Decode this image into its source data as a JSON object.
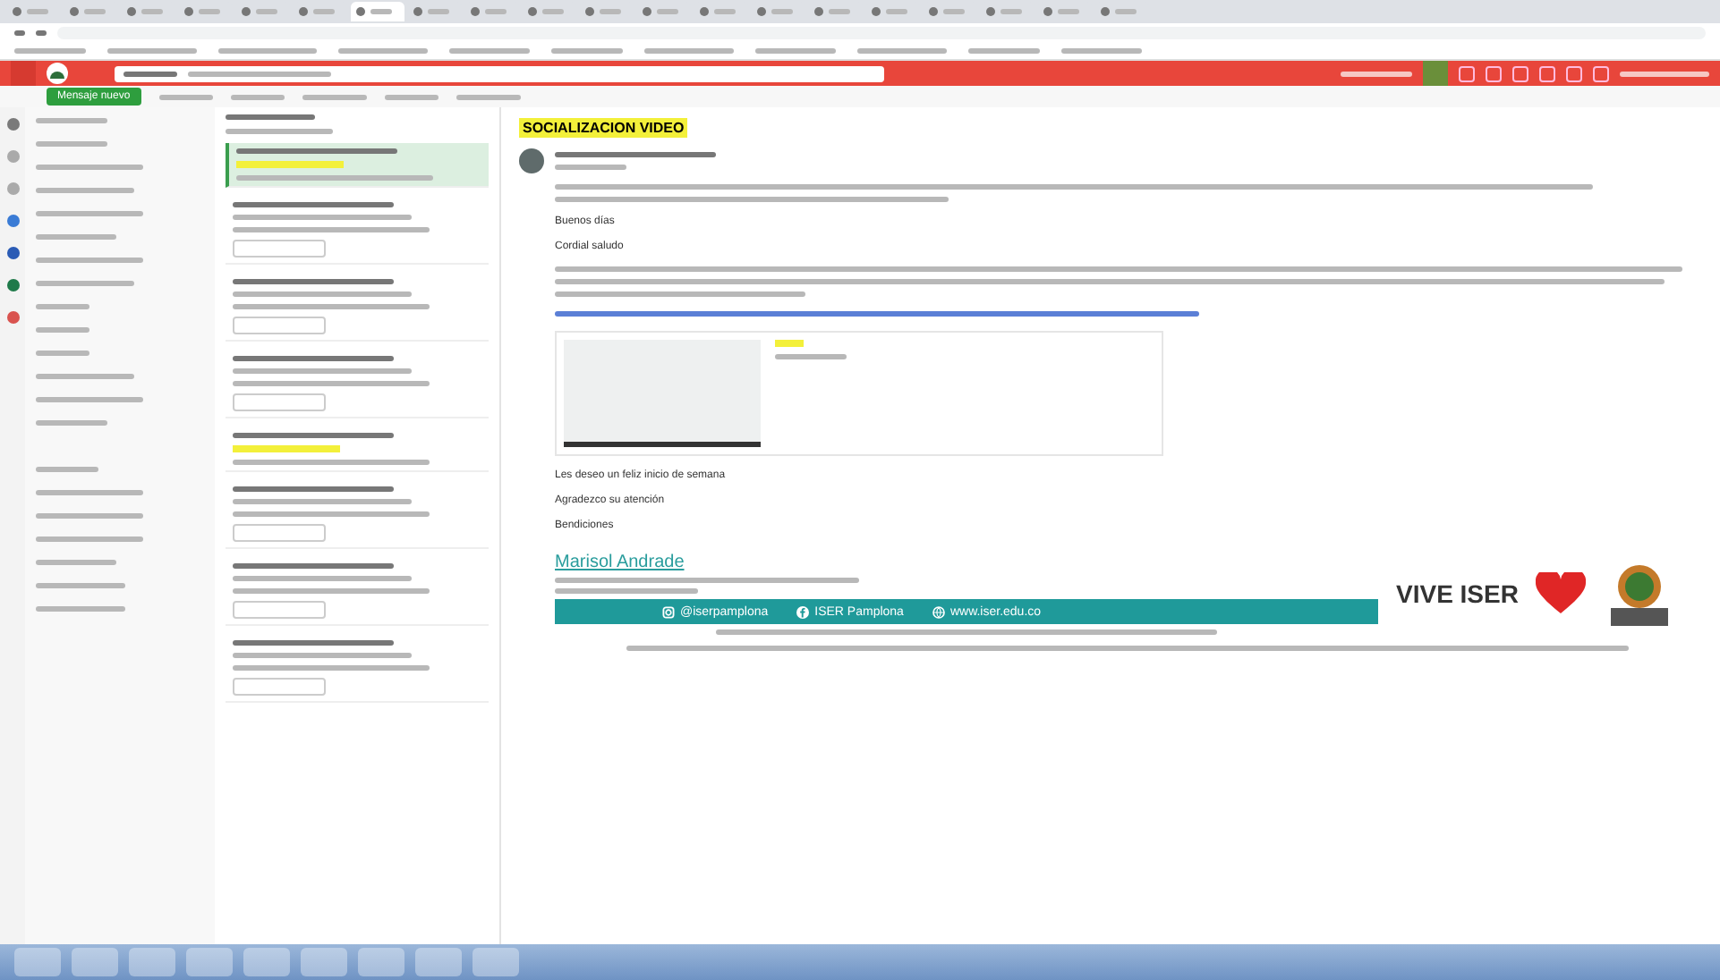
{
  "browser": {
    "tabs": [
      {
        "selected": false
      },
      {
        "selected": false
      },
      {
        "selected": false
      },
      {
        "selected": false
      },
      {
        "selected": false
      },
      {
        "selected": false
      },
      {
        "selected": true
      },
      {
        "selected": false
      },
      {
        "selected": false
      },
      {
        "selected": false
      },
      {
        "selected": false
      },
      {
        "selected": false
      },
      {
        "selected": false
      },
      {
        "selected": false
      },
      {
        "selected": false
      },
      {
        "selected": false
      },
      {
        "selected": false
      },
      {
        "selected": false
      },
      {
        "selected": false
      },
      {
        "selected": false
      }
    ]
  },
  "toolbar": {
    "new_message": "Mensaje nuevo"
  },
  "message_list": {
    "messages": [
      {
        "selected": true,
        "highlighted": true,
        "attachment": false
      },
      {
        "selected": false,
        "highlighted": false,
        "attachment": true
      },
      {
        "selected": false,
        "highlighted": false,
        "attachment": true
      },
      {
        "selected": false,
        "highlighted": false,
        "attachment": true
      },
      {
        "selected": false,
        "highlighted": true,
        "attachment": false
      },
      {
        "selected": false,
        "highlighted": false,
        "attachment": true
      },
      {
        "selected": false,
        "highlighted": false,
        "attachment": true
      },
      {
        "selected": false,
        "highlighted": false,
        "attachment": true
      }
    ]
  },
  "reading_pane": {
    "subject": "SOCIALIZACION VIDEO",
    "greeting": "Buenos días",
    "salutation": "Cordial saludo",
    "closing": [
      "Les deseo un feliz inicio de semana",
      "Agradezco su atención",
      "Bendiciones"
    ]
  },
  "signature": {
    "name": "Marisol Andrade",
    "social": [
      {
        "kind": "instagram",
        "label": "@iserpamplona"
      },
      {
        "kind": "facebook",
        "label": "ISER Pamplona"
      },
      {
        "kind": "web",
        "label": "www.iser.edu.co"
      }
    ],
    "brand": "VIVE ISER"
  }
}
